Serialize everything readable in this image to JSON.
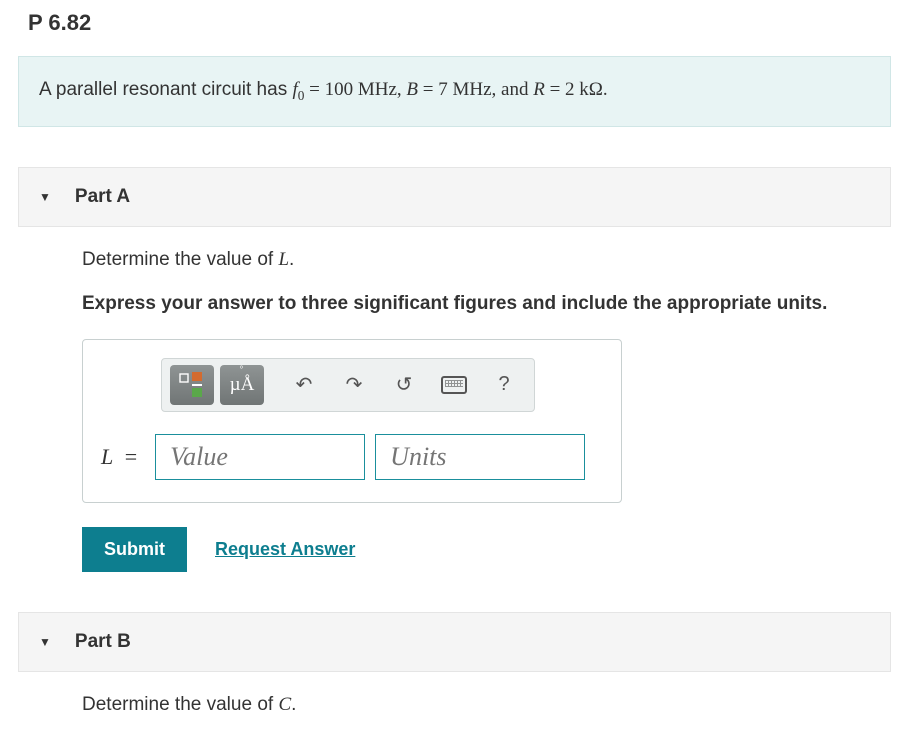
{
  "problem": {
    "number": "P 6.82",
    "statement_prefix": "A parallel resonant circuit has ",
    "f0_var": "f",
    "f0_sub": "0",
    "f0_value": " = 100 MHz, ",
    "B_var": "B",
    "B_value": " = 7 MHz, and ",
    "R_var": "R",
    "R_value": " = 2 kΩ."
  },
  "partA": {
    "label": "Part A",
    "question_prefix": "Determine the value of ",
    "question_var": "L",
    "question_suffix": ".",
    "instruction": "Express your answer to three significant figures and include the appropriate units.",
    "input_var": "L",
    "input_eq": " =",
    "value_placeholder": "Value",
    "units_placeholder": "Units",
    "toolbar_units": "µÅ",
    "help_label": "?"
  },
  "actions": {
    "submit": "Submit",
    "request": "Request Answer"
  },
  "partB": {
    "label": "Part B",
    "question_prefix": "Determine the value of ",
    "question_var": "C",
    "question_suffix": "."
  }
}
